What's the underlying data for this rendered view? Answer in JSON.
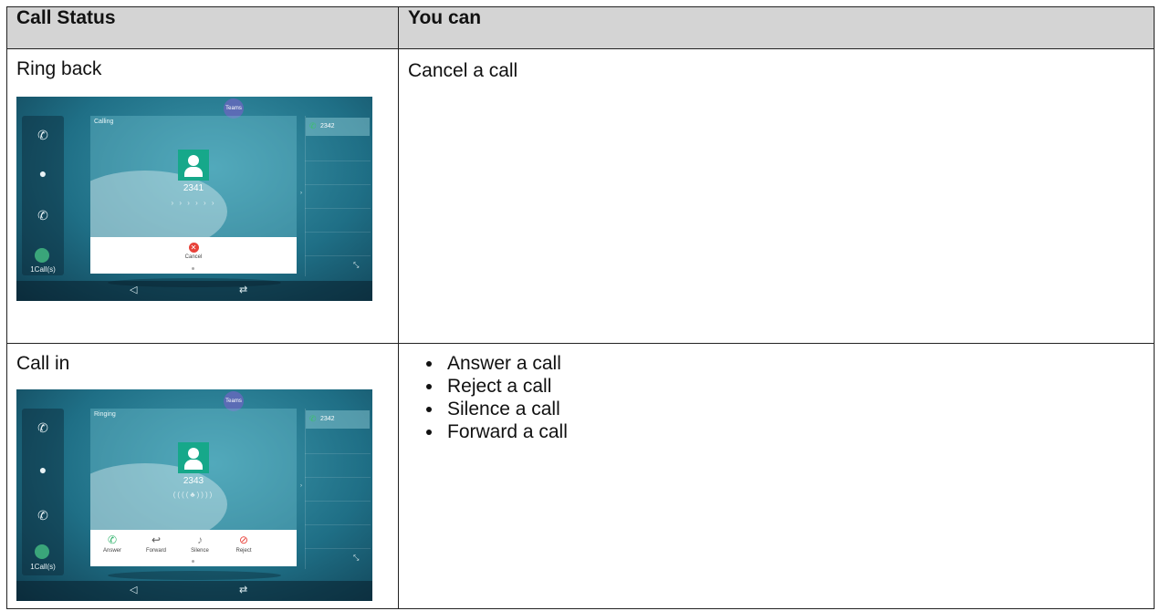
{
  "table": {
    "headers": [
      "Call Status",
      "You can"
    ],
    "rows": [
      {
        "status": "Ring back",
        "actions": [
          "Cancel a call"
        ]
      },
      {
        "status": "Call in",
        "actions": [
          "Answer a call",
          "Reject a call",
          "Silence a call",
          "Forward a call"
        ]
      }
    ]
  },
  "screens": {
    "ringback": {
      "teams": "Teams",
      "status": "Calling",
      "number": "2341",
      "progress": "› › › › › ›",
      "button": "Cancel",
      "line": "2342",
      "calls": "1Call(s)"
    },
    "callin": {
      "teams": "Teams",
      "status": "Ringing",
      "number": "2343",
      "progress": "((((♣))))",
      "buttons": [
        "Answer",
        "Forward",
        "Silence",
        "Reject"
      ],
      "line": "2342",
      "calls": "1Call(s)"
    }
  },
  "icons": {
    "phone": "phone-icon",
    "contacts": "contacts-icon",
    "history": "call-history-icon",
    "cancel": "cancel-icon",
    "answer": "answer-icon",
    "forward": "forward-icon",
    "silence": "silence-icon",
    "reject": "reject-icon"
  },
  "colors": {
    "header_bg": "#d4d4d4",
    "avatar": "#16a88a",
    "cancel": "#e8423a",
    "answer": "#2fb36b",
    "reject": "#e8423a"
  }
}
